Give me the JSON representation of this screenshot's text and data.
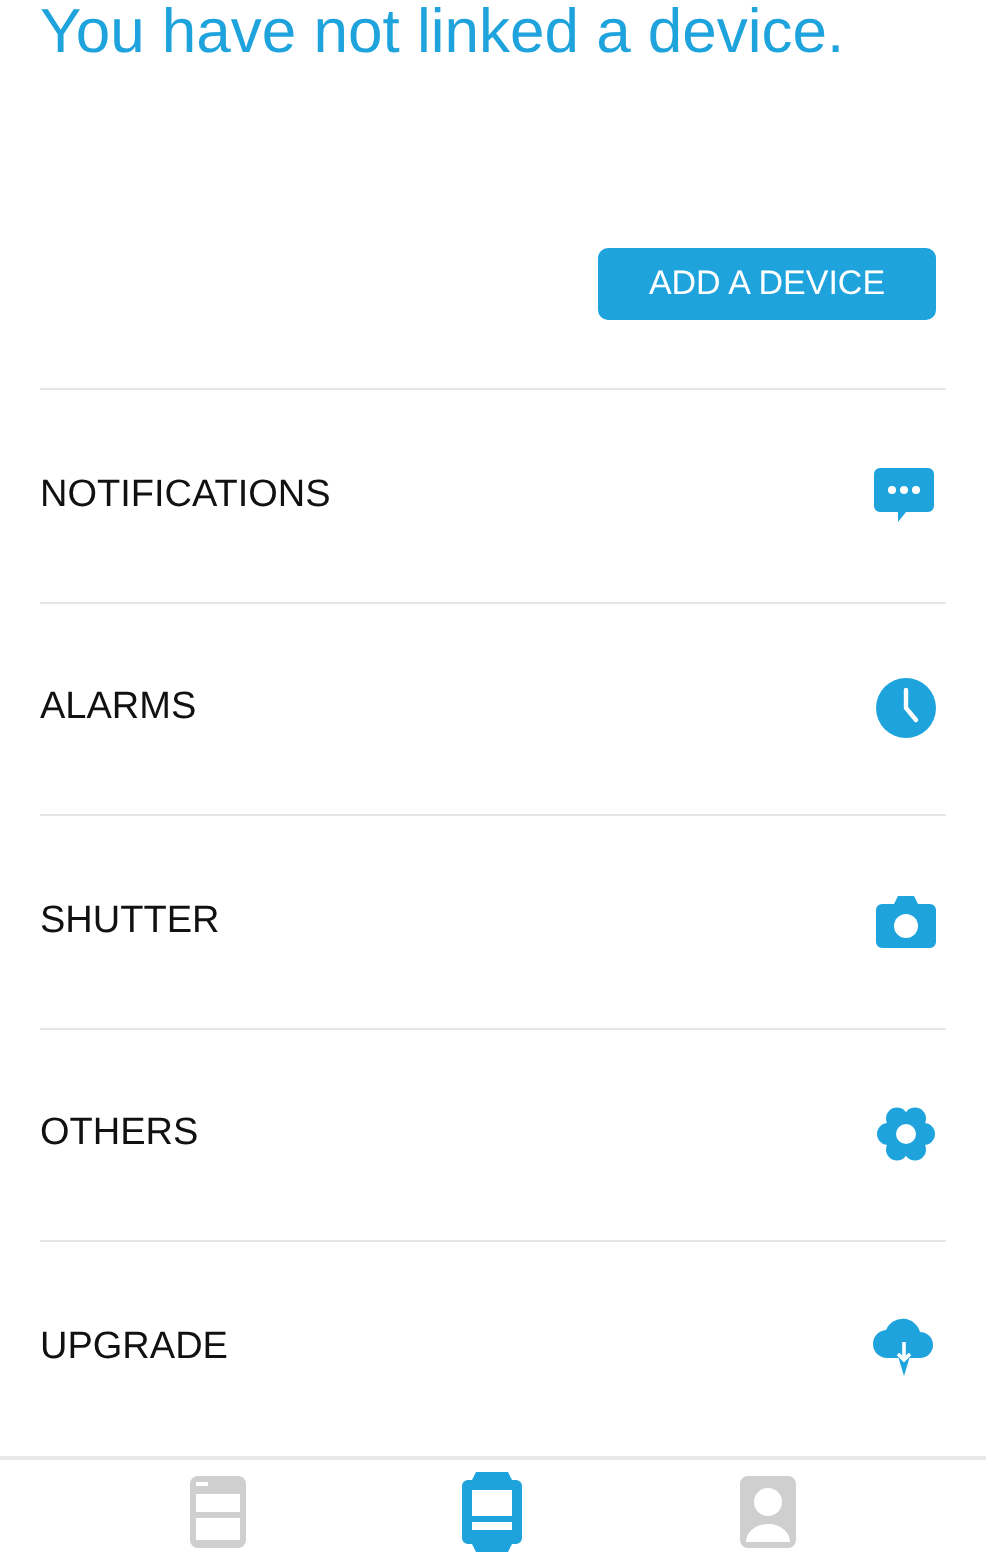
{
  "heading": "You have not linked a device.",
  "add_button": "ADD A DEVICE",
  "items": [
    {
      "label": "NOTIFICATIONS",
      "kind": "chat"
    },
    {
      "label": "ALARMS",
      "kind": "clock"
    },
    {
      "label": "SHUTTER",
      "kind": "camera"
    },
    {
      "label": "OTHERS",
      "kind": "gear"
    },
    {
      "label": "UPGRADE",
      "kind": "download"
    }
  ],
  "tabs": [
    {
      "kind": "list",
      "selected": false
    },
    {
      "kind": "watch",
      "selected": true
    },
    {
      "kind": "profile",
      "selected": false
    }
  ]
}
